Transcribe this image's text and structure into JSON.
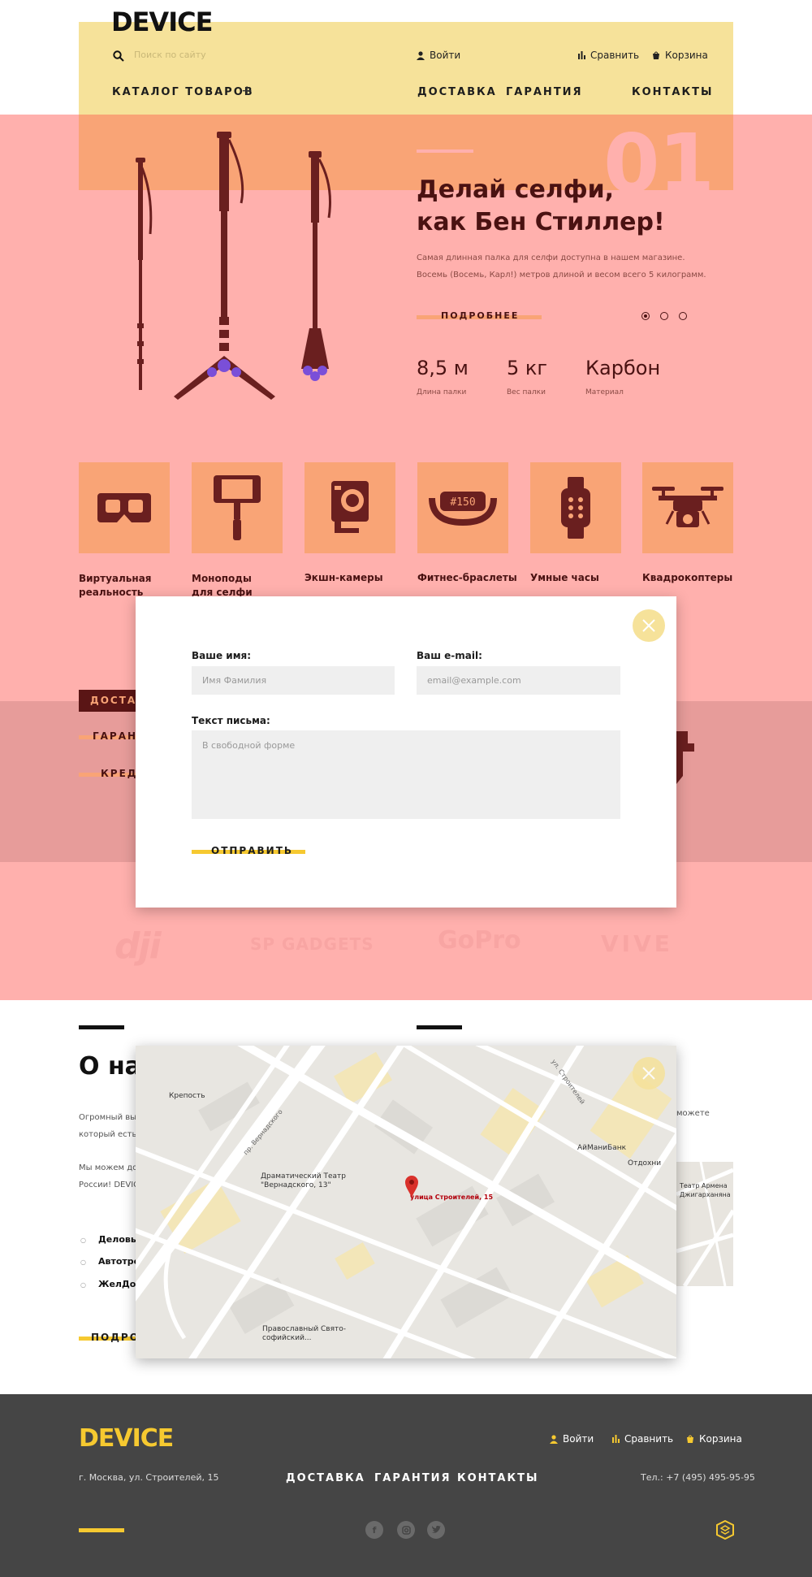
{
  "header": {
    "logo": "DEVICE",
    "search_placeholder": "Поиск по сайту",
    "login": "Войти",
    "compare": "Сравнить",
    "cart": "Корзина",
    "catalog": "КАТАЛОГ ТОВАРОВ",
    "nav": [
      "ДОСТАВКА",
      "ГАРАНТИЯ",
      "КОНТАКТЫ"
    ]
  },
  "slider": {
    "number": "01",
    "title_line1": "Делай селфи,",
    "title_line2": "как Бен Стиллер!",
    "text_line1": "Самая длинная палка для селфи доступна в нашем магазине.",
    "text_line2": "Восемь (Восемь, Карл!) метров длиной и весом всего 5 килограмм.",
    "more": "ПОДРОБНЕЕ",
    "active_slide": 1,
    "slides_count": 3,
    "specs": [
      {
        "value": "8,5 м",
        "label": "Длина палки"
      },
      {
        "value": "5 кг",
        "label": "Вес палки"
      },
      {
        "value": "Карбон",
        "label": "Материал"
      }
    ]
  },
  "categories": [
    {
      "line1": "Виртуальная",
      "line2": "реальность",
      "icon": "vr-headset-icon"
    },
    {
      "line1": "Моноподы",
      "line2": "для селфи",
      "icon": "selfie-stick-icon"
    },
    {
      "line1": "Экшн-камеры",
      "line2": "",
      "icon": "action-camera-icon"
    },
    {
      "line1": "Фитнес-браслеты",
      "line2": "",
      "icon": "fitness-band-icon"
    },
    {
      "line1": "Умные часы",
      "line2": "",
      "icon": "smartwatch-icon"
    },
    {
      "line1": "Квадрокоптеры",
      "line2": "",
      "icon": "drone-icon"
    }
  ],
  "services_partial": [
    "ДОСТА",
    "ГАРАН",
    "КРЕД"
  ],
  "brands": [
    "dji",
    "SP GADGETS",
    "GoPro",
    "VIVE"
  ],
  "about_partial": {
    "title": "О на",
    "text1": "Огромный вы",
    "text1b": "который есть",
    "text2": "Мы можем дос",
    "text2b": "России! DEVICE",
    "right_text": "можете",
    "list": [
      "Деловые",
      "Автотре",
      "ЖелДор"
    ],
    "more": "ПОДРО"
  },
  "feedback_modal": {
    "name_label": "Ваше имя:",
    "name_placeholder": "Имя Фамилия",
    "email_label": "Ваш e-mail:",
    "email_placeholder": "email@example.com",
    "message_label": "Текст письма:",
    "message_placeholder": "В свободной форме",
    "submit": "ОТПРАВИТЬ"
  },
  "map_modal": {
    "marker_label": "улица Строителей, 15",
    "places": [
      "Крепость",
      "Драматический Театр \"Вернадского, 13\"",
      "АйМаниБанк",
      "Отдохни",
      "Православный Свято-софийский...",
      "ул. Строителей",
      "пр. Вернадского"
    ],
    "peek_label1": "Театр Армена",
    "peek_label2": "Джигарханяна"
  },
  "footer": {
    "logo": "DEVICE",
    "address": "г. Москва, ул. Строителей, 15",
    "nav": [
      "ДОСТАВКА",
      "ГАРАНТИЯ",
      "КОНТАКТЫ"
    ],
    "login": "Войти",
    "compare": "Сравнить",
    "cart": "Корзина",
    "phone": "Тел.: +7 (495) 495-95-95"
  }
}
